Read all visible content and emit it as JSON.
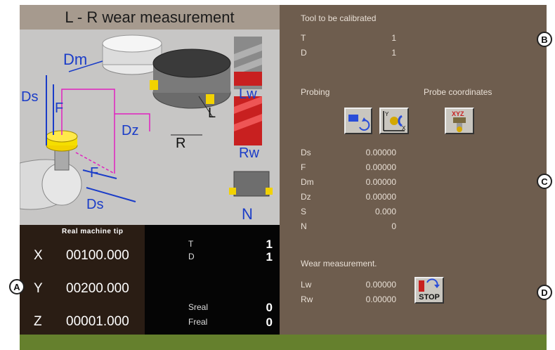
{
  "window": {
    "title": "L - R wear measurement"
  },
  "diagram_labels": {
    "dm": "Dm",
    "ds_left": "Ds",
    "f_left": "F",
    "dz": "Dz",
    "r": "R",
    "l": "L",
    "f_bottom": "F",
    "ds_bottom": "Ds",
    "lw": "Lw",
    "rw": "Rw",
    "n": "N"
  },
  "coords": {
    "header": "Real machine tip",
    "rows": [
      {
        "axis": "X",
        "value": "00100.000"
      },
      {
        "axis": "Y",
        "value": "00200.000"
      },
      {
        "axis": "Z",
        "value": "00001.000"
      }
    ]
  },
  "status": {
    "t_label": "T",
    "t_value": "1",
    "d_label": "D",
    "d_value": "1",
    "sreal_label": "Sreal",
    "sreal_value": "0",
    "freal_label": "Freal",
    "freal_value": "0"
  },
  "tool": {
    "heading": "Tool to be calibrated",
    "t_label": "T",
    "t_value": "1",
    "d_label": "D",
    "d_value": "1"
  },
  "probing": {
    "heading": "Probing",
    "coords_heading": "Probe coordinates",
    "params": [
      {
        "label": "Ds",
        "value": "0.00000"
      },
      {
        "label": "F",
        "value": "0.00000"
      },
      {
        "label": "Dm",
        "value": "0.00000"
      },
      {
        "label": "Dz",
        "value": "0.00000"
      },
      {
        "label": "S",
        "value": "0.000"
      },
      {
        "label": "N",
        "value": "0"
      }
    ]
  },
  "wear": {
    "heading": "Wear measurement.",
    "params": [
      {
        "label": "Lw",
        "value": "0.00000"
      },
      {
        "label": "Rw",
        "value": "0.00000"
      }
    ],
    "stop_label": "STOP"
  },
  "markers": {
    "a": "A",
    "b": "B",
    "c": "C",
    "d": "D"
  },
  "icons": [
    "probe-rotate-icon",
    "probe-xy-icon",
    "probe-xyz-icon",
    "stop-icon"
  ],
  "colors": {
    "background": "#6e5d4e",
    "title_bar": "#a69a8e",
    "accent_green": "#65802d",
    "dimension_blue": "#1a3cc8",
    "path_magenta": "#e020c0"
  }
}
